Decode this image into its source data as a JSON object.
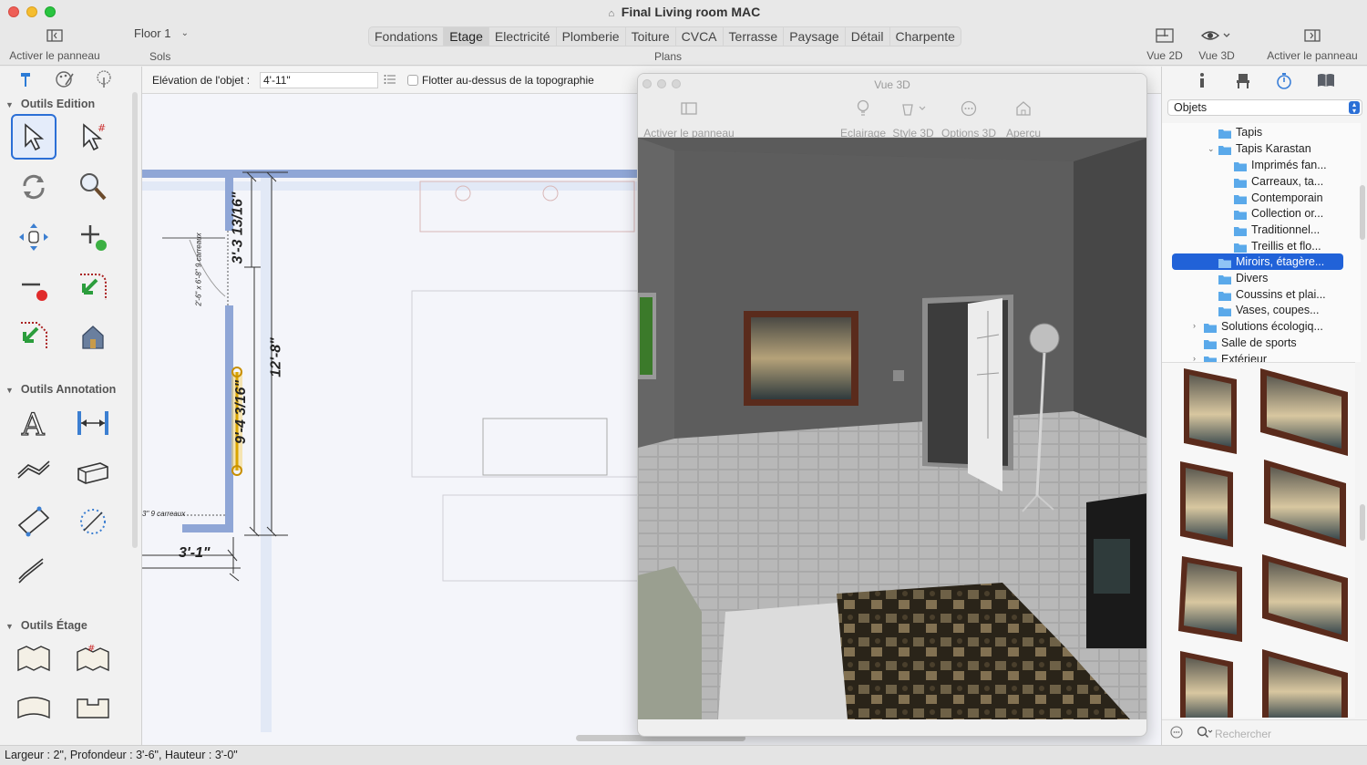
{
  "window": {
    "title": "Final Living room MAC"
  },
  "toolbar": {
    "left_panel_label": "Activer le panneau",
    "floor_value": "Floor 1",
    "floor_caption": "Sols",
    "tabs": [
      "Fondations",
      "Etage",
      "Electricité",
      "Plomberie",
      "Toiture",
      "CVCA",
      "Terrasse",
      "Paysage",
      "Détail",
      "Charpente"
    ],
    "active_tab": "Etage",
    "tabs_caption": "Plans",
    "view2d_label": "Vue 2D",
    "view3d_label": "Vue 3D",
    "right_panel_label": "Activer le panneau"
  },
  "props": {
    "elevation_label": "Elévation de l'objet :",
    "elevation_value": "4'-11\"",
    "float_label": "Flotter au-dessus de la topographie"
  },
  "left": {
    "section_edit": "Outils Edition",
    "section_annotation": "Outils Annotation",
    "section_floor": "Outils Étage"
  },
  "plan": {
    "dim_top": "3'-3 13/16\"",
    "dim_mid": "9'-4 3/16\"",
    "dim_total": "12'-8\"",
    "dim_bottom": "3'-1\"",
    "door_label": "2'-6\" x 6'-8\" 9 carreaux",
    "window_label": "3\" 9 carreaux"
  },
  "view3d": {
    "title": "Vue 3D",
    "panel_label": "Activer le panneau",
    "lighting_label": "Eclairage",
    "style_label": "Style 3D",
    "options_label": "Options 3D",
    "preview_label": "Aperçu"
  },
  "library": {
    "category": "Objets",
    "tree": [
      {
        "label": "Tapis"
      },
      {
        "label": "Tapis Karastan"
      },
      {
        "label": "Imprimés fan..."
      },
      {
        "label": "Carreaux, ta..."
      },
      {
        "label": "Contemporain"
      },
      {
        "label": "Collection or..."
      },
      {
        "label": "Traditionnel..."
      },
      {
        "label": "Treillis et flo..."
      },
      {
        "label": "Miroirs, étagère..."
      },
      {
        "label": "Divers"
      },
      {
        "label": "Coussins et plai..."
      },
      {
        "label": "Vases, coupes..."
      },
      {
        "label": "Solutions écologiq..."
      },
      {
        "label": "Salle de sports"
      },
      {
        "label": "Extérieur"
      }
    ],
    "selected": "Miroirs, étagère...",
    "search_placeholder": "Rechercher"
  },
  "status": {
    "text": "Largeur : 2\", Profondeur : 3'-6\", Hauteur : 3'-0\""
  },
  "colors": {
    "accent": "#2162d8",
    "wall": "#8fa6d6",
    "highlight": "#f0c419"
  }
}
